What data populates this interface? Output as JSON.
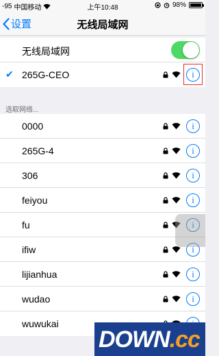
{
  "status_bar": {
    "signal": "-95",
    "carrier": "中国移动",
    "time": "上午10:48",
    "battery": "98%",
    "battery_level": 0.98
  },
  "nav": {
    "back_label": "设置",
    "title": "无线局域网"
  },
  "wlan_toggle": {
    "label": "无线局域网",
    "on": true
  },
  "connected": {
    "name": "265G-CEO",
    "info_label": "i"
  },
  "section_header": "选取网络...",
  "networks": [
    {
      "name": "0000",
      "info_label": "i"
    },
    {
      "name": "265G-4",
      "info_label": "i"
    },
    {
      "name": "306",
      "info_label": "i"
    },
    {
      "name": "feiyou",
      "info_label": "i"
    },
    {
      "name": "fu",
      "info_label": "i"
    },
    {
      "name": "ifiw",
      "info_label": "i"
    },
    {
      "name": "lijianhua",
      "info_label": "i"
    },
    {
      "name": "wudao",
      "info_label": "i"
    },
    {
      "name": "wuwukai",
      "info_label": "i"
    }
  ],
  "watermark": {
    "main": "DOWN",
    "suffix": ".cc"
  },
  "colors": {
    "accent": "#007aff",
    "toggle_on": "#4cd964",
    "highlight": "#e03030"
  }
}
